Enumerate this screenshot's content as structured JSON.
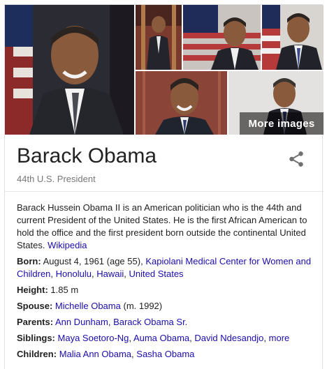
{
  "gallery": {
    "more_images_label": "More images"
  },
  "header": {
    "title": "Barack Obama",
    "subtitle": "44th U.S. President"
  },
  "description": {
    "text": "Barack Hussein Obama II is an American politician who is the 44th and current President of the United States. He is the first African American to hold the office and the first president born outside the continental United States.",
    "source_link": "Wikipedia"
  },
  "facts": {
    "born": {
      "label": "Born:",
      "text": "August 4, 1961 (age 55),",
      "links": [
        "Kapiolani Medical Center for Women and Children",
        "Honolulu",
        "Hawaii",
        "United States"
      ],
      "separator": ","
    },
    "height": {
      "label": "Height:",
      "value": "1.85 m"
    },
    "spouse": {
      "label": "Spouse:",
      "link": "Michelle Obama",
      "suffix": "(m. 1992)"
    },
    "parents": {
      "label": "Parents:",
      "links": [
        "Ann Dunham",
        "Barack Obama Sr."
      ]
    },
    "siblings": {
      "label": "Siblings:",
      "links": [
        "Maya Soetoro-Ng",
        "Auma Obama",
        "David Ndesandjo",
        "more"
      ]
    },
    "children": {
      "label": "Children:",
      "links": [
        "Malia Ann Obama",
        "Sasha Obama"
      ]
    }
  },
  "colors": {
    "link": "#1a0dab",
    "text": "#222222",
    "muted": "#777777"
  },
  "icons": {
    "share": "share-icon"
  }
}
